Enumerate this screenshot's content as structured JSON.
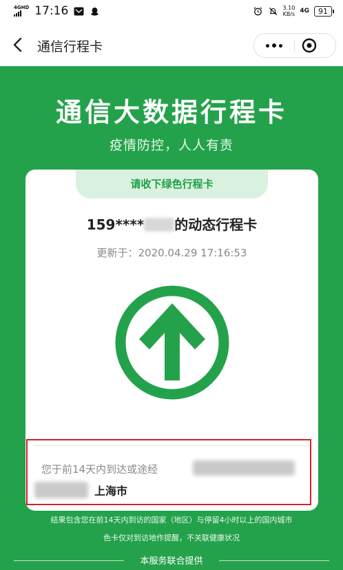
{
  "status_bar": {
    "network": "4GHD",
    "time": "17:16",
    "speed_value": "3.10",
    "speed_unit": "KB/s",
    "network_right": "4G",
    "battery": "91"
  },
  "nav": {
    "title": "通信行程卡"
  },
  "header": {
    "title": "通信大数据行程卡",
    "subtitle": "疫情防控，人人有责"
  },
  "card": {
    "tab_label": "请收下绿色行程卡",
    "phone_prefix": "159****",
    "phone_suffix": "的动态行程卡",
    "update_text": "更新于：2020.04.29 17:16:53",
    "status_color": "#24a24b",
    "visited_text": "您于前14天内到达或途经",
    "city": "上海市"
  },
  "notes": {
    "line1": "结果包含您在前14天内到访的国家（地区）与停留4小时以上的国内城市",
    "line2": "色卡仅对到访地作提醒，不关联健康状况"
  },
  "footer": {
    "text": "本服务联合提供"
  },
  "colors": {
    "green": "#24a24b",
    "highlight_red": "#d6202d"
  }
}
